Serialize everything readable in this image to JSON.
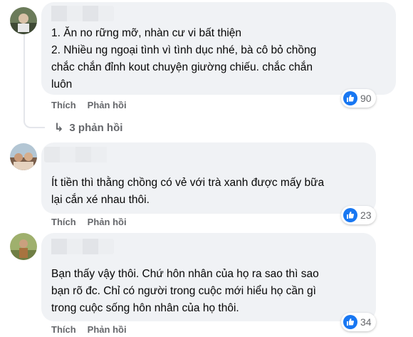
{
  "comments": [
    {
      "lines": [
        "1. Ăn no rững mỡ, nhàn cư vi bất thiện",
        "2. Nhiều ng ngoại tình vì tình dục nhé, bà cô bỏ chồng",
        "chắc chắn đỉnh kout chuyện giường chiếu. chắc chắn",
        "luôn"
      ],
      "reaction_count": "90",
      "like_label": "Thích",
      "reply_label": "Phản hồi",
      "replies_link": "3 phản hồi"
    },
    {
      "lines": [
        "Ít tiền thì thằng chồng có vẻ với trà xanh được mấy bữa",
        "lại cắn xé nhau thôi."
      ],
      "reaction_count": "23",
      "like_label": "Thích",
      "reply_label": "Phản hồi"
    },
    {
      "lines": [
        "Bạn thấy vậy thôi. Chứ hôn nhân của họ ra sao thì sao",
        "bạn rõ đc. Chỉ có người trong cuộc mới hiểu họ cần gì",
        "trong cuộc sống hôn nhân của họ thôi."
      ],
      "reaction_count": "34",
      "like_label": "Thích",
      "reply_label": "Phản hồi"
    }
  ],
  "colors": {
    "bubble": "#f0f2f5",
    "secondary_text": "#65676b",
    "like_blue": "#1877f2"
  }
}
